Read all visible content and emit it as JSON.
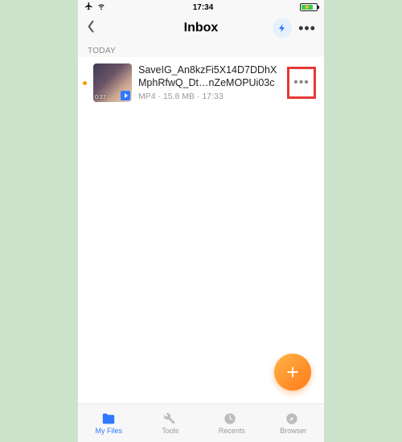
{
  "status": {
    "time": "17:34"
  },
  "header": {
    "title": "Inbox"
  },
  "section": {
    "label": "TODAY"
  },
  "file": {
    "name": "SaveIG_An8kzFi5X14D7DDhXMphRfwQ_Dt…nZeMOPUi03c",
    "type": "MP4",
    "size": "15.8 MB",
    "time": "17:33",
    "duration": "0:37"
  },
  "fab": {
    "label": "+"
  },
  "tabs": [
    {
      "id": "my-files",
      "label": "My Files",
      "active": true
    },
    {
      "id": "tools",
      "label": "Tools",
      "active": false
    },
    {
      "id": "recents",
      "label": "Recents",
      "active": false
    },
    {
      "id": "browser",
      "label": "Browser",
      "active": false
    }
  ]
}
